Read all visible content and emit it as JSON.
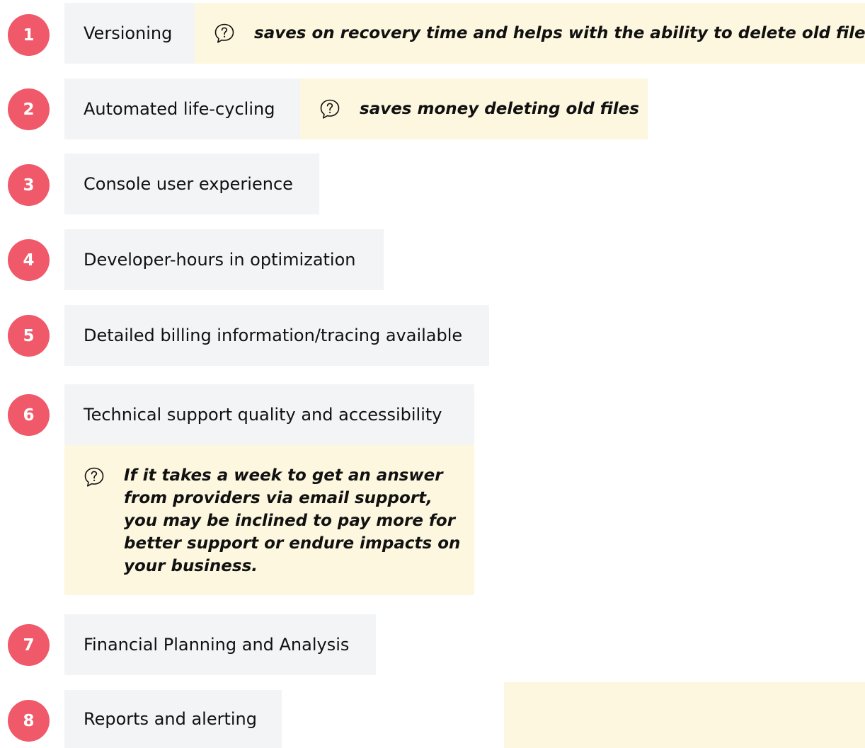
{
  "items": [
    {
      "number": "1",
      "label": "Versioning",
      "note": "saves on recovery time and helps with the ability to delete old files"
    },
    {
      "number": "2",
      "label": "Automated life-cycling",
      "note": "saves money deleting old files"
    },
    {
      "number": "3",
      "label": "Console user experience"
    },
    {
      "number": "4",
      "label": "Developer-hours in optimization"
    },
    {
      "number": "5",
      "label": "Detailed billing information/tracing available"
    },
    {
      "number": "6",
      "label": "Technical support quality and accessibility",
      "note": "If it takes a week to get an answer from providers via email support, you may be inclined to pay more for better support or endure impacts on your business."
    },
    {
      "number": "7",
      "label": "Financial Planning and Analysis"
    },
    {
      "number": "8",
      "label": "Reports and alerting"
    }
  ],
  "colors": {
    "badge": "#f0596a",
    "label_background": "#f3f4f6",
    "note_background": "#fdf7df"
  },
  "icons": {
    "note_icon": "question-speech-bubble-icon"
  }
}
